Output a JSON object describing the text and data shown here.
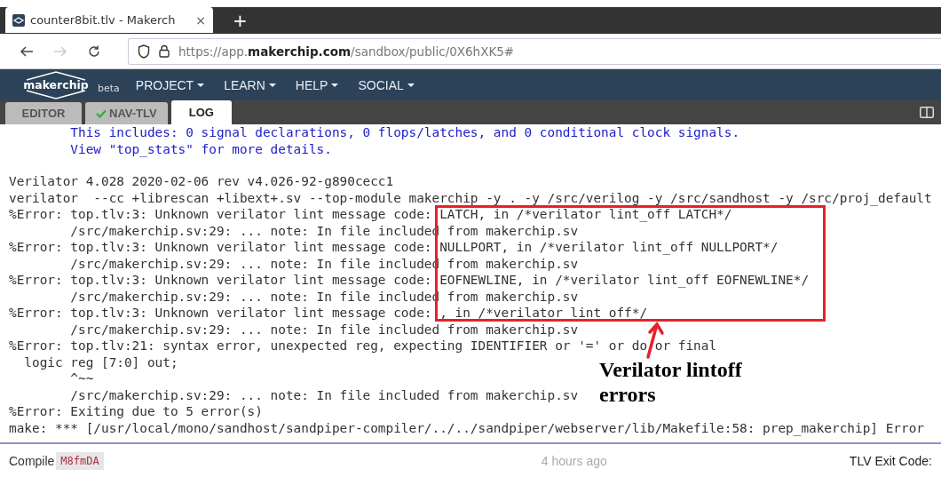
{
  "browser": {
    "tab": {
      "title": "counter8bit.tlv - Makerch",
      "close": "×"
    },
    "new_tab": "+",
    "nav": {
      "back": true,
      "forward": false
    },
    "url": "https://app.**makerchip.com**/sandbox/public/0X6hXK5#"
  },
  "app_nav": {
    "logo": "makerchip",
    "badge": "beta",
    "menus": [
      "PROJECT",
      "LEARN",
      "HELP",
      "SOCIAL"
    ]
  },
  "tabs": [
    {
      "label": "EDITOR",
      "selected": false,
      "checked": false
    },
    {
      "label": "NAV-TLV",
      "selected": false,
      "checked": true
    },
    {
      "label": "LOG",
      "selected": true,
      "checked": false
    }
  ],
  "log_blocks": [
    {
      "kind": "info",
      "lines": [
        "        This includes: 0 signal declarations, 0 flops/latches, and 0 conditional clock signals.",
        "        View \"top_stats\" for more details."
      ]
    },
    {
      "kind": "plain",
      "lines": [
        "Verilator 4.028 2020-02-06 rev v4.026-92-g890cecc1",
        "verilator  --cc +librescan +libext+.sv --top-module makerchip -y . -y /src/verilog -y /src/sandhost -y /src/proj_default",
        "%Error: top.tlv:3: Unknown verilator lint message code: LATCH, in /*verilator lint_off LATCH*/",
        "        /src/makerchip.sv:29: ... note: In file included from makerchip.sv",
        "%Error: top.tlv:3: Unknown verilator lint message code: NULLPORT, in /*verilator lint_off NULLPORT*/",
        "        /src/makerchip.sv:29: ... note: In file included from makerchip.sv",
        "%Error: top.tlv:3: Unknown verilator lint message code: EOFNEWLINE, in /*verilator lint_off EOFNEWLINE*/",
        "        /src/makerchip.sv:29: ... note: In file included from makerchip.sv",
        "%Error: top.tlv:3: Unknown verilator lint message code: , in /*verilator lint_off*/",
        "        /src/makerchip.sv:29: ... note: In file included from makerchip.sv",
        "%Error: top.tlv:21: syntax error, unexpected reg, expecting IDENTIFIER or '=' or do or final",
        "  logic reg [7:0] out;",
        "        ^~~",
        "        /src/makerchip.sv:29: ... note: In file included from makerchip.sv",
        "%Error: Exiting due to 5 error(s)",
        "make: *** [/usr/local/mono/sandhost/sandpiper-compiler/../../sandpiper/webserver/lib/Makefile:58: prep_makerchip] Error"
      ]
    }
  ],
  "annotation": {
    "label": "Verilator lintoff errors"
  },
  "status_bar": {
    "label": "Compile",
    "id": "M8fmDA",
    "time": "4 hours ago",
    "exit_code": "TLV Exit Code:"
  }
}
